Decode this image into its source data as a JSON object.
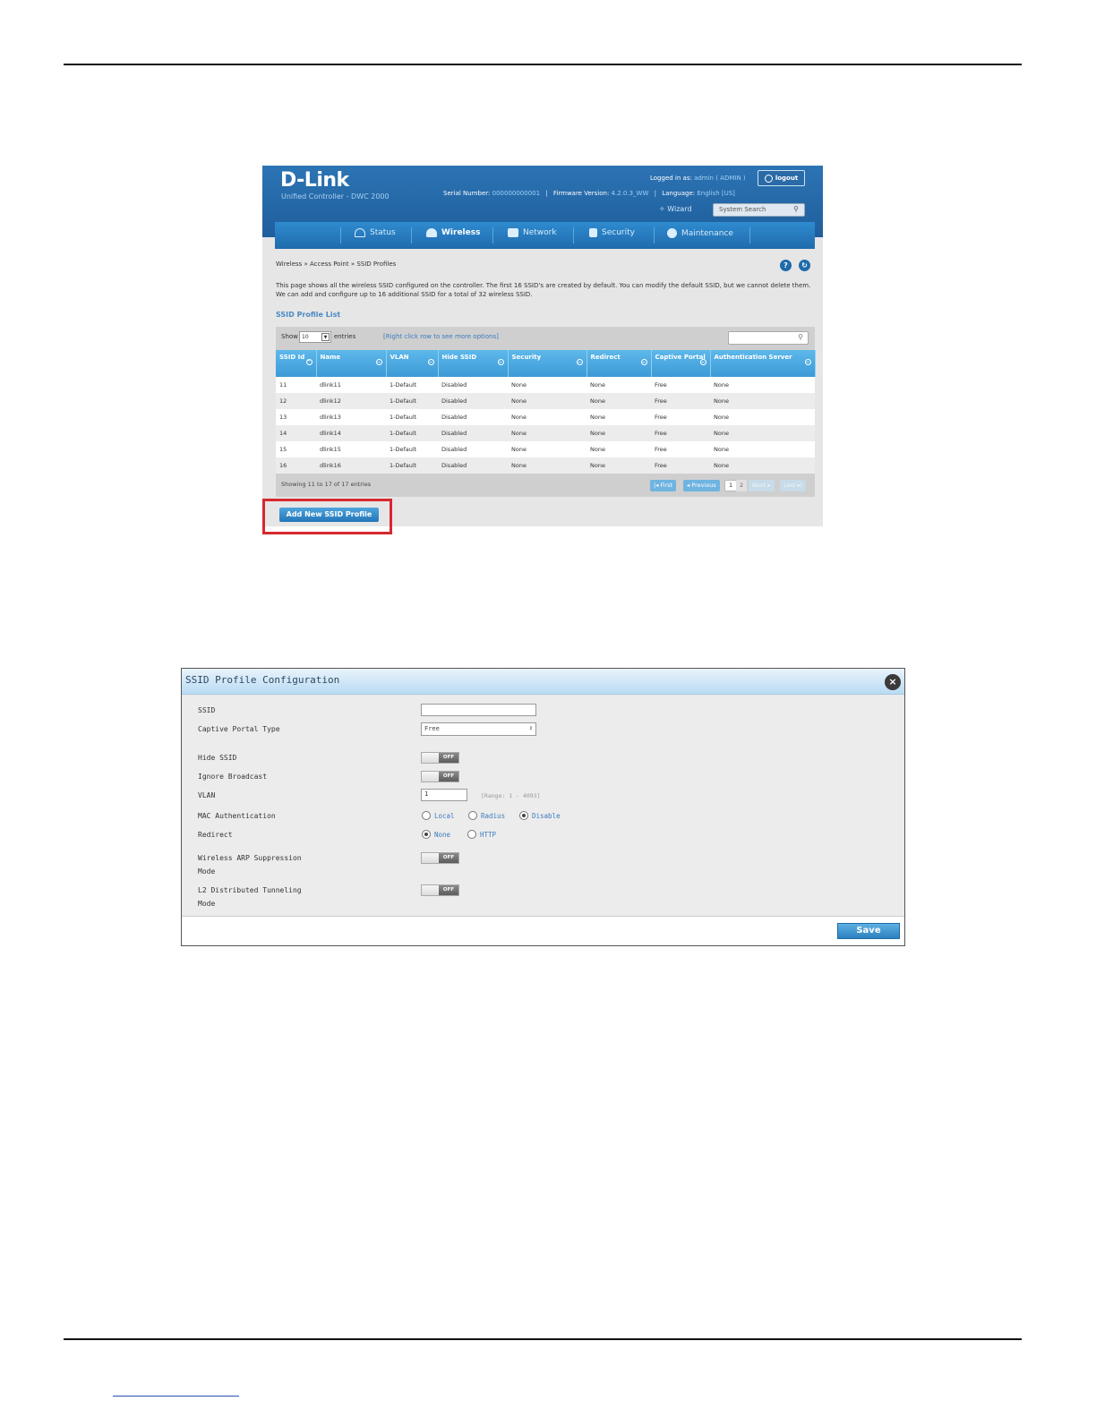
{
  "controller": {
    "logo": "D-Link",
    "subtitle": "Unified Controller - DWC 2000",
    "logged_in_label": "Logged in as:",
    "logged_in_user": "admin ( ADMIN )",
    "logout_label": "logout",
    "serial_label": "Serial Number:",
    "serial_value": "000000000001",
    "firmware_label": "Firmware Version:",
    "firmware_value": "4.2.0.3_WW",
    "language_label": "Language:",
    "language_value": "English [US]",
    "wizard_label": "Wizard",
    "search_placeholder": "System Search",
    "nav": [
      {
        "label": "Status",
        "icon": "gauge-icon"
      },
      {
        "label": "Wireless",
        "icon": "wifi-icon"
      },
      {
        "label": "Network",
        "icon": "network-icon"
      },
      {
        "label": "Security",
        "icon": "lock-icon"
      },
      {
        "label": "Maintenance",
        "icon": "gear-icon"
      }
    ],
    "breadcrumb": "Wireless  »  Access Point  »  SSID Profiles",
    "description": "This page shows all the wireless SSID configured on the controller. The first 16 SSID's are created by default. You can modify the default SSID, but we cannot delete them. We can add and configure up to 16 additional SSID for a total of 32 wireless SSID.",
    "list_title": "SSID Profile List",
    "show_label": "Show",
    "entries_value": "10",
    "entries_label": "entries",
    "hint": "[Right click row to see more options]",
    "columns": [
      "SSID Id",
      "Name",
      "VLAN",
      "Hide SSID",
      "Security",
      "Redirect",
      "Captive Portal",
      "Authentication Server"
    ],
    "rows": [
      [
        "11",
        "dlink11",
        "1-Default",
        "Disabled",
        "None",
        "None",
        "Free",
        "None"
      ],
      [
        "12",
        "dlink12",
        "1-Default",
        "Disabled",
        "None",
        "None",
        "Free",
        "None"
      ],
      [
        "13",
        "dlink13",
        "1-Default",
        "Disabled",
        "None",
        "None",
        "Free",
        "None"
      ],
      [
        "14",
        "dlink14",
        "1-Default",
        "Disabled",
        "None",
        "None",
        "Free",
        "None"
      ],
      [
        "15",
        "dlink15",
        "1-Default",
        "Disabled",
        "None",
        "None",
        "Free",
        "None"
      ],
      [
        "16",
        "dlink16",
        "1-Default",
        "Disabled",
        "None",
        "None",
        "Free",
        "None"
      ]
    ],
    "showing": "Showing 11 to 17 of 17 entries",
    "pager": {
      "first": "First",
      "previous": "Previous",
      "page1": "1",
      "page2": "2",
      "next": "Next",
      "last": "Last"
    },
    "add_button": "Add New SSID Profile",
    "highlight_color": "#d7282f"
  },
  "dialog": {
    "title": "SSID Profile Configuration",
    "fields": {
      "ssid": "SSID",
      "captive_portal_type": "Captive Portal Type",
      "hide_ssid": "Hide SSID",
      "ignore_broadcast": "Ignore Broadcast",
      "vlan": "VLAN",
      "mac_authentication": "MAC Authentication",
      "redirect": "Redirect",
      "arp_line1": "Wireless ARP Suppression",
      "arp_line2": "Mode",
      "l2_line1": "L2 Distributed Tunneling",
      "l2_line2": "Mode"
    },
    "ssid_value": "",
    "captive_portal_value": "Free",
    "toggle_off": "OFF",
    "vlan_value": "1",
    "vlan_range": "[Range: 1 - 4093]",
    "mac_options": {
      "local": "Local",
      "radius": "Radius",
      "disable": "Disable"
    },
    "redirect_options": {
      "none": "None",
      "http": "HTTP"
    },
    "save_label": "Save"
  }
}
